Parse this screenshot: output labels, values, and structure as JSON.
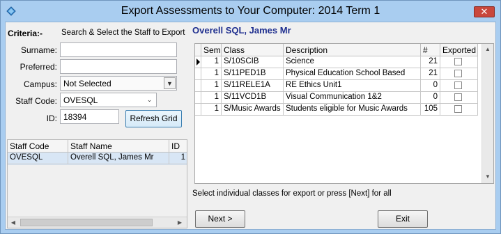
{
  "window": {
    "title": "Export Assessments to Your Computer:  2014 Term 1",
    "close_label": "✕"
  },
  "criteria": {
    "heading": "Criteria:-",
    "hint": "Search & Select the Staff to Export",
    "surname_label": "Surname:",
    "surname_value": "",
    "preferred_label": "Preferred:",
    "preferred_value": "",
    "campus_label": "Campus:",
    "campus_value": "Not Selected",
    "staff_code_label": "Staff Code:",
    "staff_code_value": "OVESQL",
    "id_label": "ID:",
    "id_value": "18394",
    "refresh_label": "Refresh Grid"
  },
  "staff_grid": {
    "columns": [
      "Staff Code",
      "Staff Name",
      "ID"
    ],
    "rows": [
      {
        "code": "OVESQL",
        "name": "Overell SQL, James Mr",
        "id": "1"
      }
    ]
  },
  "selected_staff": "Overell SQL, James Mr",
  "class_grid": {
    "columns": [
      "Sem",
      "Class",
      "Description",
      "#",
      "Exported"
    ],
    "rows": [
      {
        "sem": "1",
        "class": "S/10SCIB",
        "description": "Science",
        "count": "21",
        "exported": false
      },
      {
        "sem": "1",
        "class": "S/11PED1B",
        "description": "Physical Education School Based",
        "count": "21",
        "exported": false
      },
      {
        "sem": "1",
        "class": "S/11RELE1A",
        "description": "RE Ethics Unit1",
        "count": "0",
        "exported": false
      },
      {
        "sem": "1",
        "class": "S/11VCD1B",
        "description": "Visual Communication 1&2",
        "count": "0",
        "exported": false
      },
      {
        "sem": "1",
        "class": "S/Music Awards",
        "description": "Students eligible for Music Awards",
        "count": "105",
        "exported": false
      }
    ]
  },
  "instruction": "Select individual classes for export or press [Next] for all",
  "buttons": {
    "next": "Next >",
    "exit": "Exit"
  },
  "colors": {
    "title_bar": "#a9cdf0",
    "selected_staff_text": "#1f2f8f",
    "grid_selection": "#d8e6f5"
  }
}
